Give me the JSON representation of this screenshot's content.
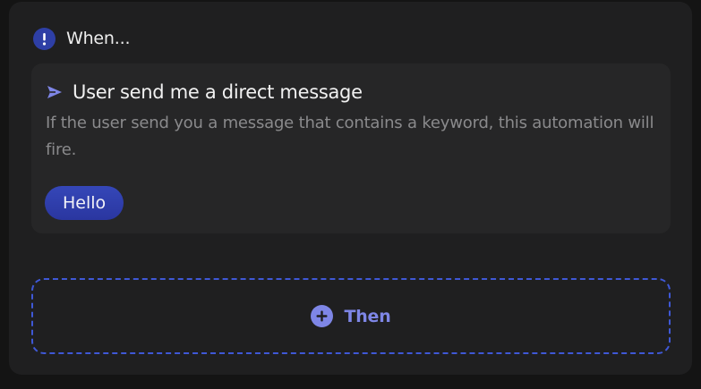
{
  "trigger_section": {
    "heading": "When...",
    "icon": "alert-icon",
    "trigger": {
      "icon": "send-icon",
      "title": "User send me a direct message",
      "description": "If the user send you a message that contains a keyword, this automation will fire.",
      "keywords": [
        "Hello"
      ]
    }
  },
  "action_section": {
    "add_label": "Then",
    "icon": "plus-icon"
  },
  "colors": {
    "accent": "#3f58d6",
    "accent_light": "#7e86e6",
    "chip": "#2e3fa6",
    "card_bg": "#1f1f20",
    "trigger_bg": "#262627"
  }
}
